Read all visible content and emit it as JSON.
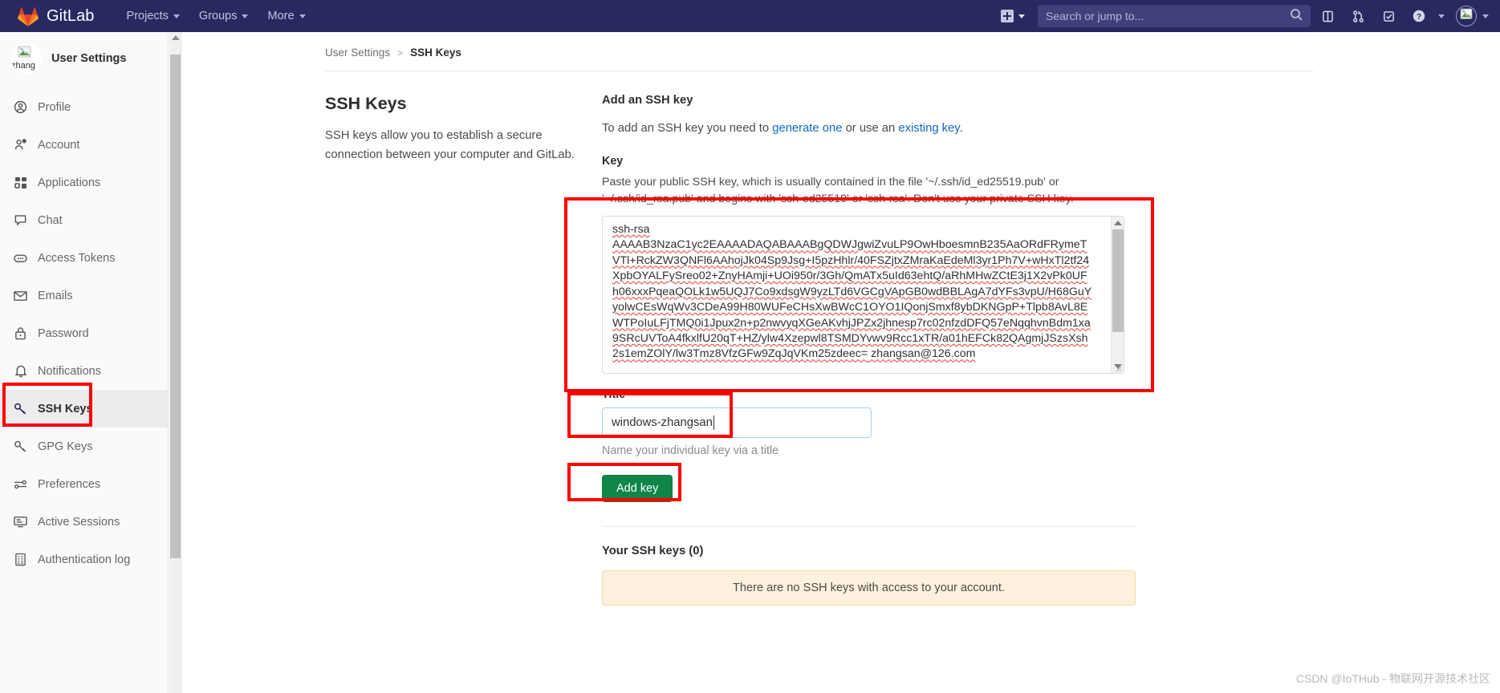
{
  "navbar": {
    "brand": "GitLab",
    "brand_icon": "gitlab-logo-icon",
    "links": [
      {
        "label": "Projects",
        "icon": "chevron-down-icon"
      },
      {
        "label": "Groups",
        "icon": "chevron-down-icon"
      },
      {
        "label": "More",
        "icon": "chevron-down-icon"
      }
    ],
    "create_new_icon": "plus-square-icon",
    "search": {
      "placeholder": "Search or jump to...",
      "icon": "search-icon"
    },
    "icons": [
      "issues-icon",
      "merge-requests-icon",
      "todos-icon",
      "help-question-icon"
    ],
    "avatar_icon": "broken-image-avatar-icon",
    "colors": {
      "bar": "#292961",
      "search_field": "#40407a"
    }
  },
  "sidebar": {
    "avatar_alt": "zhang",
    "title": "User Settings",
    "items": [
      {
        "label": "Profile",
        "icon": "user-circle-icon",
        "active": false
      },
      {
        "label": "Account",
        "icon": "account-gear-icon",
        "active": false
      },
      {
        "label": "Applications",
        "icon": "applications-grid-icon",
        "active": false
      },
      {
        "label": "Chat",
        "icon": "chat-bubble-icon",
        "active": false
      },
      {
        "label": "Access Tokens",
        "icon": "token-pill-icon",
        "active": false
      },
      {
        "label": "Emails",
        "icon": "envelope-icon",
        "active": false
      },
      {
        "label": "Password",
        "icon": "lock-icon",
        "active": false
      },
      {
        "label": "Notifications",
        "icon": "bell-icon",
        "active": false
      },
      {
        "label": "SSH Keys",
        "icon": "key-icon",
        "active": true
      },
      {
        "label": "GPG Keys",
        "icon": "key-icon",
        "active": false
      },
      {
        "label": "Preferences",
        "icon": "sliders-icon",
        "active": false
      },
      {
        "label": "Active Sessions",
        "icon": "monitor-icon",
        "active": false
      },
      {
        "label": "Authentication log",
        "icon": "log-list-icon",
        "active": false
      }
    ]
  },
  "breadcrumb": {
    "parent": "User Settings",
    "separator": ">",
    "current": "SSH Keys"
  },
  "page": {
    "heading": "SSH Keys",
    "description": "SSH keys allow you to establish a secure connection between your computer and GitLab."
  },
  "form": {
    "section_title": "Add an SSH key",
    "intro_prefix": "To add an SSH key you need to ",
    "intro_link1": "generate one",
    "intro_middle": " or use an ",
    "intro_link2": "existing key",
    "intro_suffix": ".",
    "key_label": "Key",
    "key_help": "Paste your public SSH key, which is usually contained in the file '~/.ssh/id_ed25519.pub' or '~/.ssh/id_rsa.pub' and begins with 'ssh-ed25519' or 'ssh-rsa'. Don't use your private SSH key.",
    "key_value_line1": "ssh-rsa",
    "key_value_body": "AAAAB3NzaC1yc2EAAAADAQABAAABgQDWJgwiZvuLP9OwHboesmnB235AaORdFRymeTVTl+RckZW3QNFl6AAhojJk04Sp9Jsg+I5pzHhlr/40FSZjtxZMraKaEdeMl3yr1Ph7V+wHxTl2tf24XpbOYALFySreo02+ZnyHAmji+UOi950r/3Gh/QmATx5uId63ehtQ/aRhMHwZCtE3j1X2vPk0UFh06xxxPqeaQOLk1w5UQJ7Co9xdsgW9yzLTd6VGCgVApGB0wdBBLAgA7dYFs3vpU/H68GuYyolwCEsWqWv3CDeA99H80WUFeCHsXwBWcC1OYO1IQonjSmxf8ybDKNGpP+Tlpb8AvL8EWTPoIuLFjTMQ0i1Jpux2n+p2nwvyqXGeAKvhjJPZx2jhnesp7rc02nfzdDFQ57eNqqhvnBdm1xa9SRcUVToA4fkxlfU20qT+HZ/ylw4Xzepwl8TSMDYvwv9Rcc1xTR/a01hEFCk82QAgmjJSzsXsh2s1emZOlY/lw3Tmz8VfzGFw9ZqJqVKm25zdeec=",
    "key_value_email": " zhangsan@126.com",
    "title_label": "Title",
    "title_value": "windows-zhangsan",
    "title_help": "Name your individual key via a title",
    "submit_label": "Add key",
    "submit_color": "#108548"
  },
  "keys_section": {
    "heading": "Your SSH keys (0)",
    "empty_message": "There are no SSH keys with access to your account."
  },
  "annotations": {
    "highlight_color": "#ff0000",
    "boxes": [
      "ssh-keys-sidebar-item",
      "key-textarea",
      "title-input",
      "add-key-button"
    ]
  },
  "watermark": "CSDN @IoTHub - 物联网开源技术社区"
}
